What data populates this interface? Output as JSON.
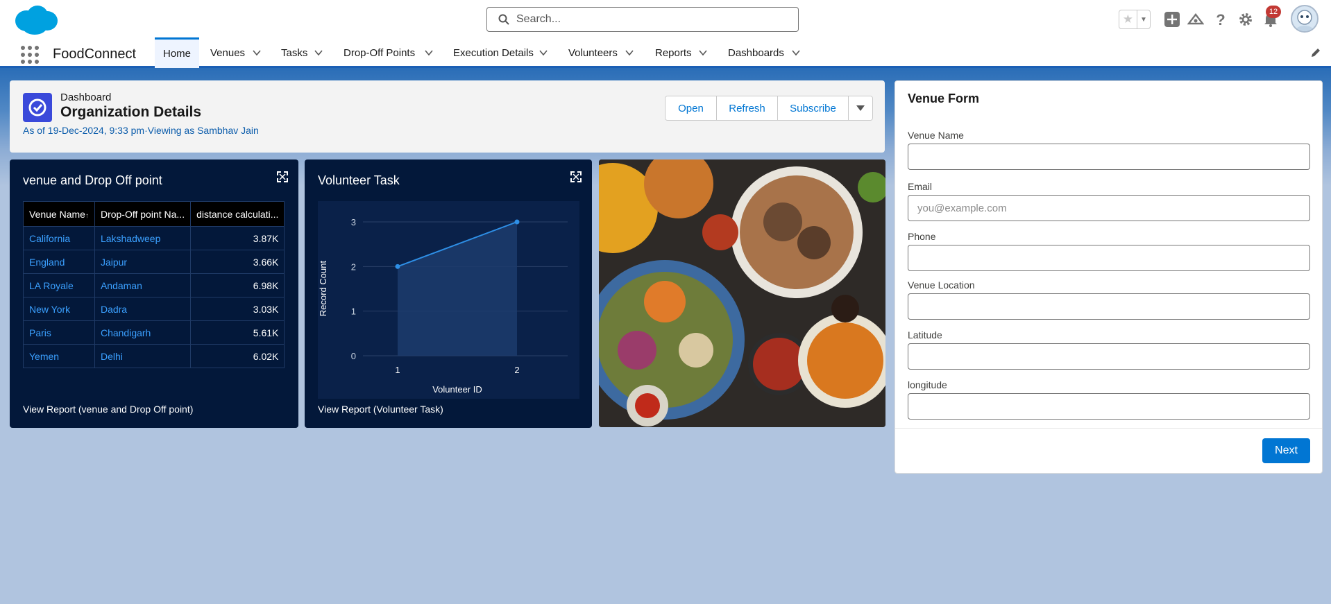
{
  "app": {
    "name": "FoodConnect"
  },
  "search": {
    "placeholder": "Search..."
  },
  "header": {
    "notification_count": "12"
  },
  "nav": {
    "items": [
      {
        "label": "Home",
        "active": true
      },
      {
        "label": "Venues"
      },
      {
        "label": "Tasks"
      },
      {
        "label": "Drop-Off Points"
      },
      {
        "label": "Execution Details"
      },
      {
        "label": "Volunteers"
      },
      {
        "label": "Reports"
      },
      {
        "label": "Dashboards"
      }
    ]
  },
  "dashboard": {
    "type_label": "Dashboard",
    "title": "Organization Details",
    "meta": "As of 19-Dec-2024, 9:33 pm·Viewing as Sambhav Jain",
    "buttons": {
      "open": "Open",
      "refresh": "Refresh",
      "subscribe": "Subscribe"
    }
  },
  "widget_table": {
    "title": "venue and Drop Off point",
    "columns": [
      "Venue Name",
      "Drop-Off point Na...",
      "distance calculati..."
    ],
    "rows": [
      [
        "California",
        "Lakshadweep",
        "3.87K"
      ],
      [
        "England",
        "Jaipur",
        "3.66K"
      ],
      [
        "LA Royale",
        "Andaman",
        "6.98K"
      ],
      [
        "New York",
        "Dadra",
        "3.03K"
      ],
      [
        "Paris",
        "Chandigarh",
        "5.61K"
      ],
      [
        "Yemen",
        "Delhi",
        "6.02K"
      ]
    ],
    "footer": "View Report (venue and Drop Off point)"
  },
  "widget_chart": {
    "title": "Volunteer Task",
    "footer": "View Report (Volunteer Task)"
  },
  "chart_data": {
    "type": "area",
    "x": [
      1,
      2
    ],
    "series": [
      {
        "values": [
          2,
          3
        ]
      }
    ],
    "xlabel": "Volunteer ID",
    "ylabel": "Record Count",
    "ylim": [
      0,
      3
    ],
    "yticks": [
      0,
      1,
      2,
      3
    ],
    "xticks": [
      1,
      2
    ],
    "grid": true,
    "color": "#2e8fe6"
  },
  "venue_form": {
    "title": "Venue Form",
    "fields": [
      {
        "label": "Venue Name",
        "value": "",
        "placeholder": ""
      },
      {
        "label": "Email",
        "value": "",
        "placeholder": "you@example.com"
      },
      {
        "label": "Phone",
        "value": "",
        "placeholder": ""
      },
      {
        "label": "Venue Location",
        "value": "",
        "placeholder": ""
      },
      {
        "label": "Latitude",
        "value": "",
        "placeholder": ""
      },
      {
        "label": "longitude",
        "value": "",
        "placeholder": ""
      }
    ],
    "next_label": "Next"
  },
  "colors": {
    "brand": "#0176d3",
    "widget_bg": "#03183a",
    "link": "#3ba0ff",
    "badge": "#c23934"
  }
}
